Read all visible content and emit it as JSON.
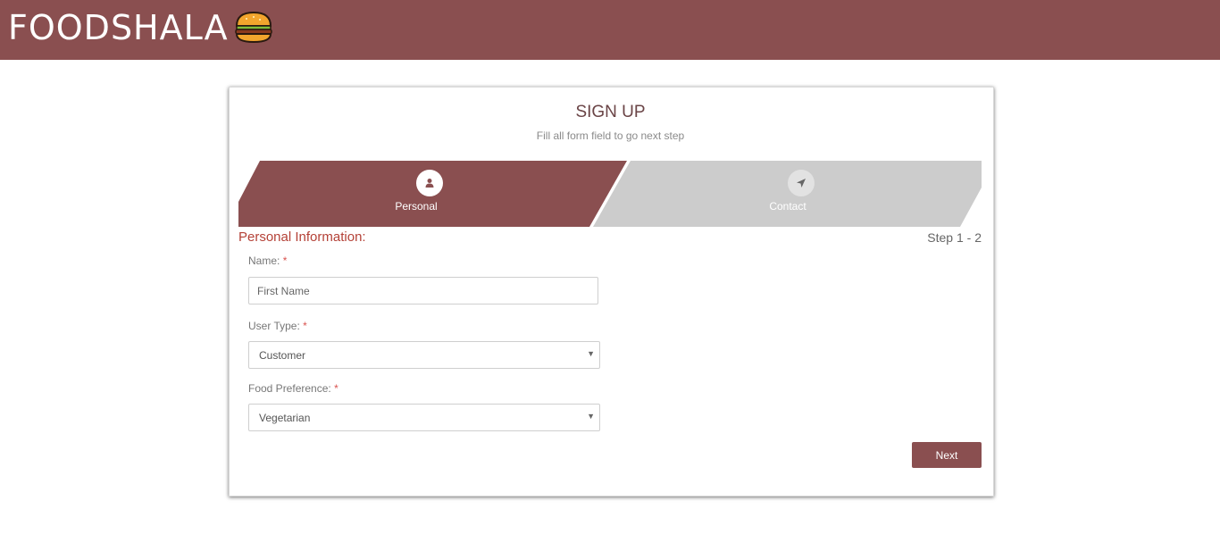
{
  "header": {
    "brand": "FOODSHALA",
    "logo_icon": "burger-icon",
    "bg_color": "#8a4f50"
  },
  "form": {
    "title": "SIGN UP",
    "subtitle": "Fill all form field to go next step",
    "steps": [
      {
        "label": "Personal",
        "icon": "user-icon",
        "active": true
      },
      {
        "label": "Contact",
        "icon": "location-arrow-icon",
        "active": false
      }
    ],
    "section_title": "Personal Information:",
    "step_indicator": "Step 1 - 2",
    "fields": {
      "name": {
        "label": "Name:",
        "required_mark": "*",
        "placeholder": "First Name",
        "value": ""
      },
      "user_type": {
        "label": "User Type:",
        "required_mark": "*",
        "selected": "Customer"
      },
      "food_preference": {
        "label": "Food Preference:",
        "required_mark": "*",
        "selected": "Vegetarian"
      }
    },
    "next_label": "Next"
  },
  "colors": {
    "accent": "#8a4f50",
    "inactive_step": "#cccccc",
    "section_title": "#b44137"
  }
}
